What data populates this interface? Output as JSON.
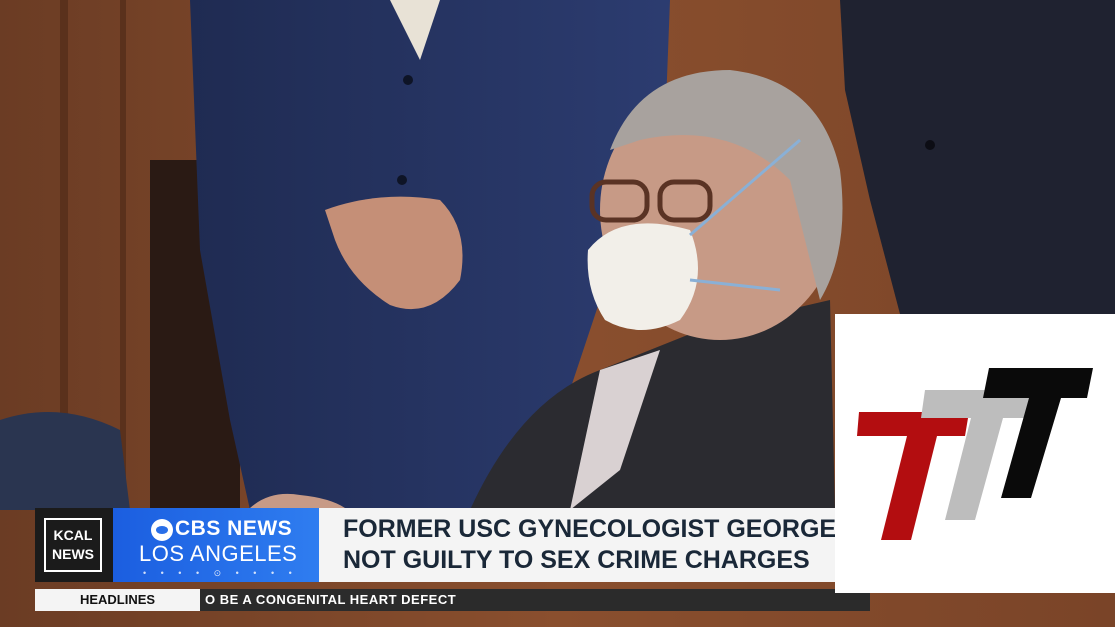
{
  "lower_third": {
    "station_badge": "KCAL\nNEWS",
    "station_line1": "KCAL",
    "station_line2": "NEWS",
    "network_name": "CBS NEWS",
    "network_city": "LOS ANGELES",
    "network_dots": "• • • • ⊙ • • • •",
    "headline_line1": "FORMER USC GYNECOLOGIST GEORGE TY",
    "headline_line2": "NOT GUILTY TO SEX CRIME CHARGES"
  },
  "ticker": {
    "label": "HEADLINES",
    "text": "O BE A CONGENITAL HEART DEFECT"
  },
  "colors": {
    "cbs_blue": "#2a6fe8",
    "logo_red": "#b30d10",
    "logo_gray": "#bdbdbd",
    "logo_black": "#0a0a0a"
  },
  "icons": {
    "cbs_logo": "cbs-eye-icon",
    "brand_logo": "ttt-logo-icon"
  }
}
